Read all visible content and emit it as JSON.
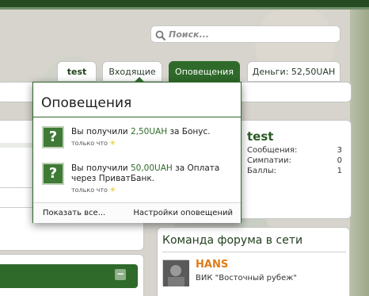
{
  "search": {
    "placeholder": "Поиск..."
  },
  "tabs": {
    "user": "test",
    "inbox": "Входящие",
    "alerts": "Оповещения",
    "money": "Деньги: 52,50UAH"
  },
  "popup": {
    "title": "Оповещения",
    "notifications": [
      {
        "prefix": "Вы получили ",
        "amount": "2,50UAH",
        "suffix": " за Бонус.",
        "time": "только что"
      },
      {
        "prefix": "Вы получили ",
        "amount": "50,00UAH",
        "suffix": " за Оплата через ПриватБанк.",
        "time": "только что"
      }
    ],
    "show_all": "Показать все...",
    "settings": "Настройки оповещений"
  },
  "profile": {
    "username": "test",
    "stats": [
      {
        "label": "Сообщения:",
        "value": "3"
      },
      {
        "label": "Симпатии:",
        "value": "0"
      },
      {
        "label": "Баллы:",
        "value": "1"
      }
    ]
  },
  "team": {
    "title": "Команда форума в сети",
    "member": {
      "name": "HANS",
      "rank": "ВИК \"Восточный рубеж\""
    }
  },
  "colors": {
    "accent": "#2f6a2b",
    "staff_name": "#e07b17"
  },
  "icons": {
    "search": "search-icon",
    "question": "question-icon"
  }
}
